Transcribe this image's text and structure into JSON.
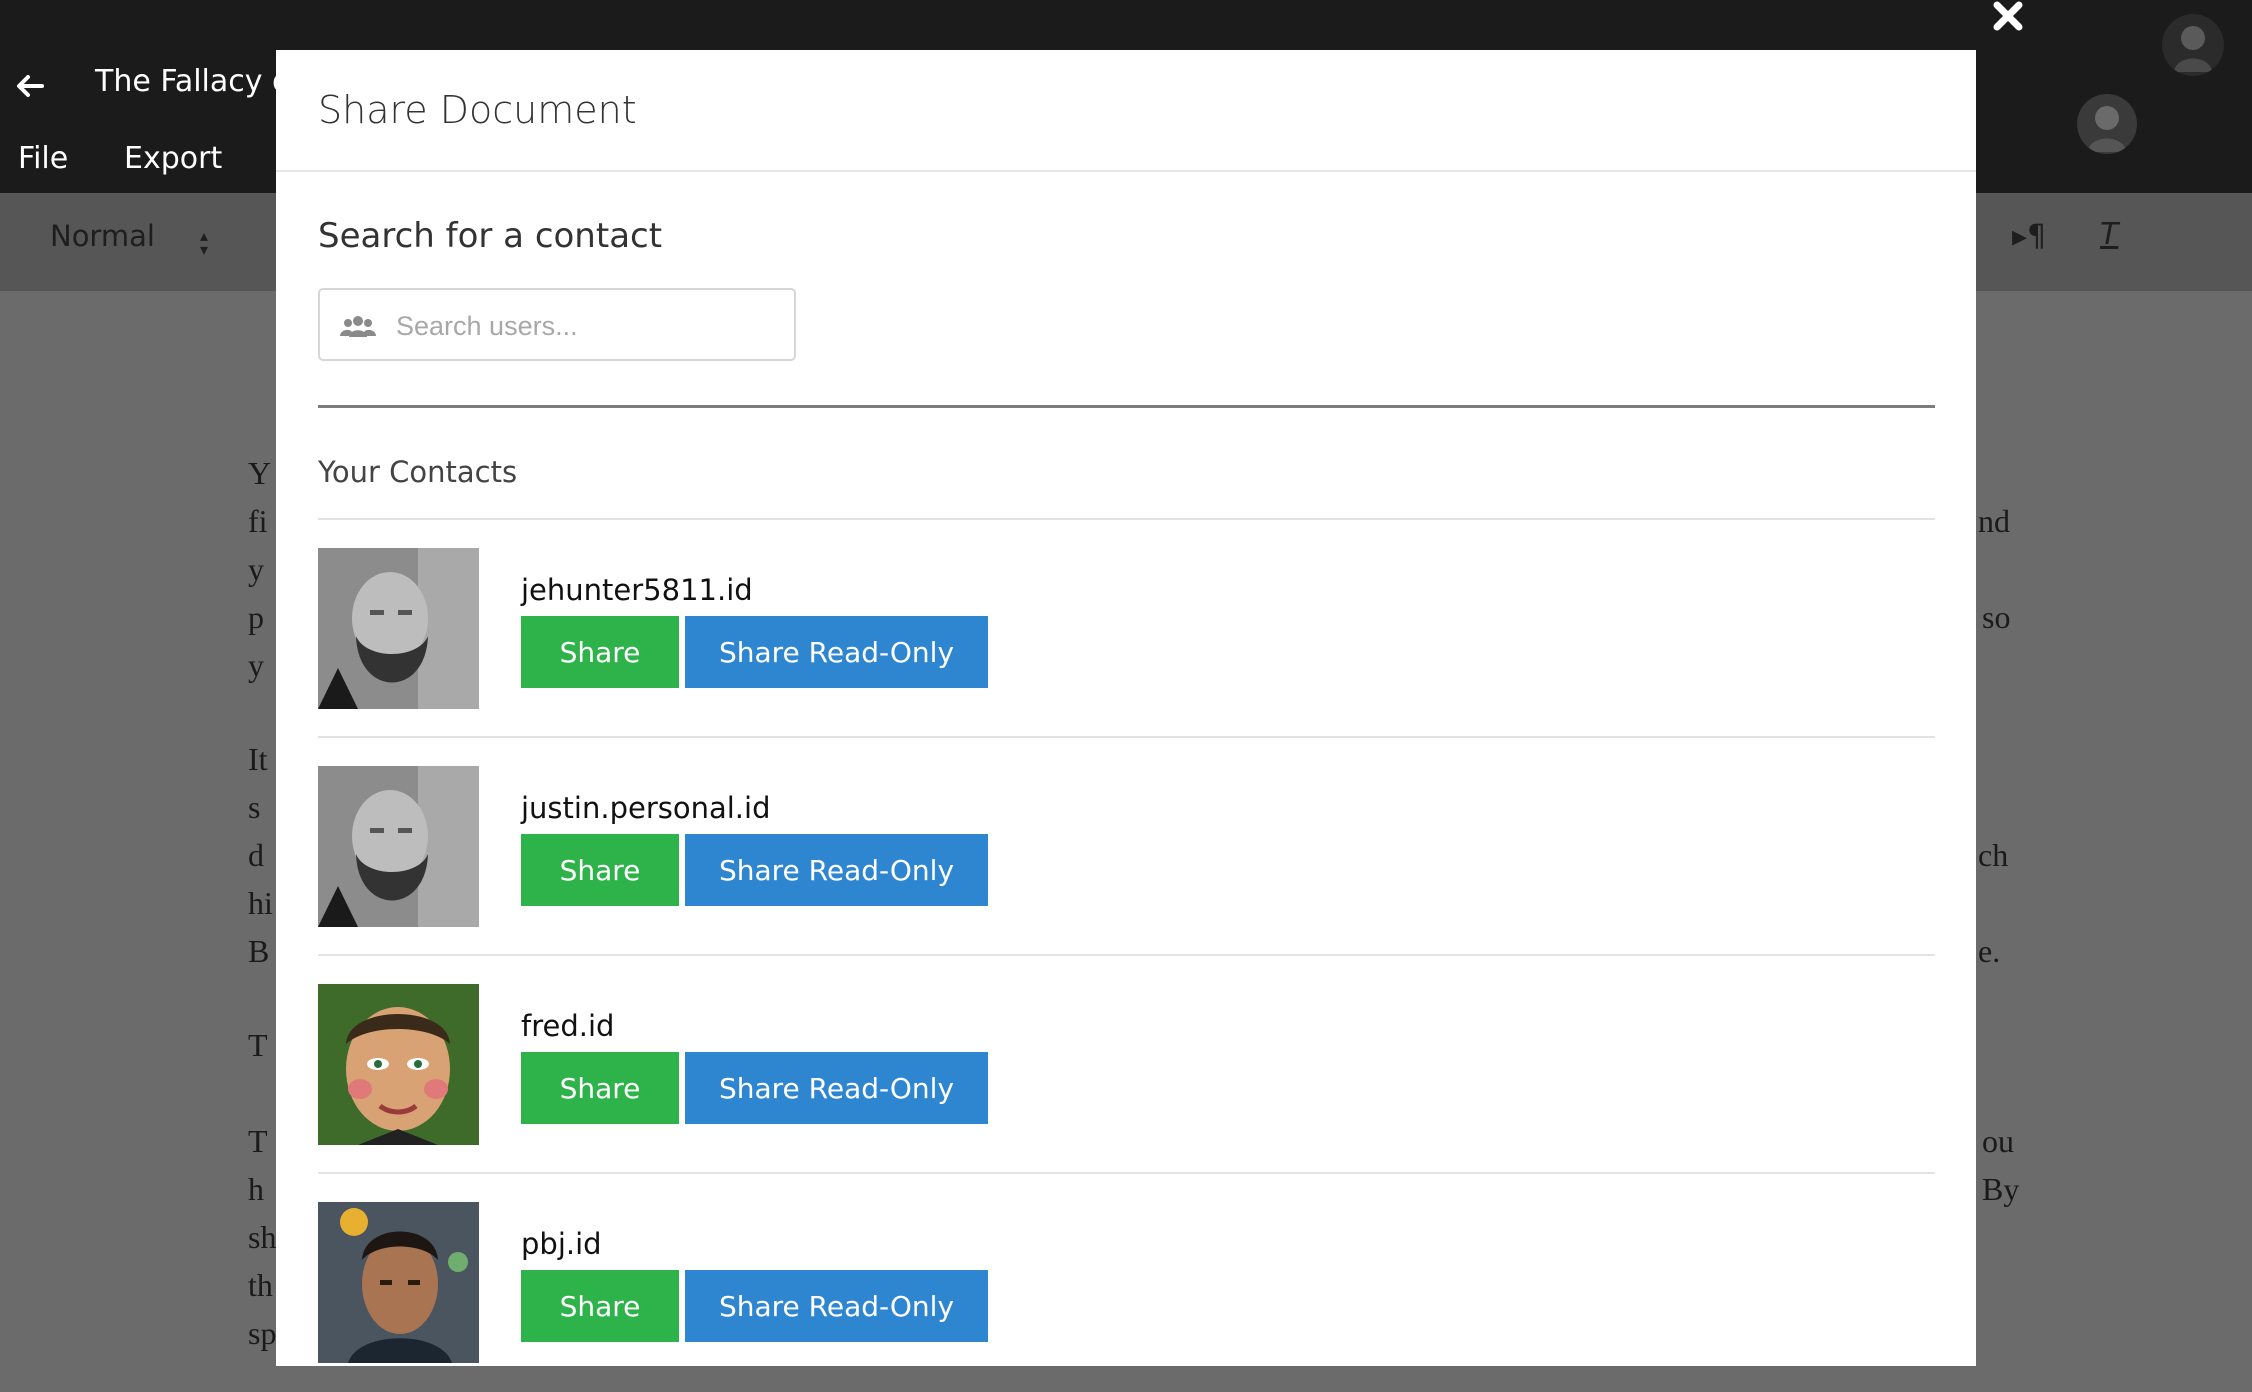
{
  "app": {
    "doc_title": "The Fallacy of",
    "menu": {
      "file": "File",
      "export": "Export"
    },
    "toolbar": {
      "style_value": "Normal"
    },
    "document_fragments": {
      "left": [
        "Y",
        "fi",
        "y",
        "p",
        "y",
        "It",
        "s",
        "d",
        "hi",
        "B",
        "T",
        "T",
        "h",
        "sh",
        "th",
        "sp"
      ],
      "right": [
        "nd",
        "so",
        "ch",
        "e.",
        "ou",
        "By"
      ]
    }
  },
  "modal": {
    "title": "Share Document",
    "search": {
      "label": "Search for a contact",
      "placeholder": "Search users..."
    },
    "contacts_heading": "Your Contacts",
    "contacts": [
      {
        "name": "jehunter5811.id",
        "share_label": "Share",
        "readonly_label": "Share Read-Only"
      },
      {
        "name": "justin.personal.id",
        "share_label": "Share",
        "readonly_label": "Share Read-Only"
      },
      {
        "name": "fred.id",
        "share_label": "Share",
        "readonly_label": "Share Read-Only"
      },
      {
        "name": "pbj.id",
        "share_label": "Share",
        "readonly_label": "Share Read-Only"
      }
    ]
  },
  "colors": {
    "share_button": "#2db34a",
    "readonly_button": "#2e86d1",
    "backdrop": "#6b6b6b",
    "header": "#1b1b1b"
  },
  "icons": {
    "back": "arrow-left-icon",
    "close": "close-icon",
    "search": "users-icon",
    "pilcrow": "paragraph-icon",
    "clear_format": "clear-format-icon"
  }
}
